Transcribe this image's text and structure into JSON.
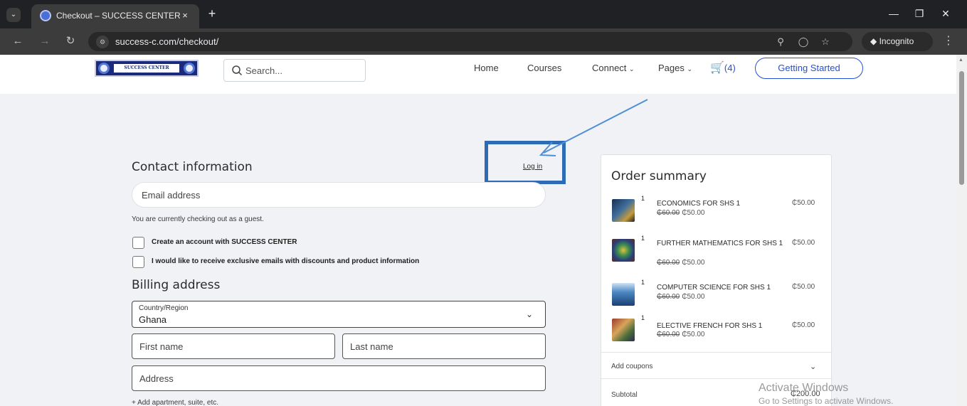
{
  "browser": {
    "tab_title": "Checkout – SUCCESS CENTER",
    "tab_close": "×",
    "new_tab": "+",
    "url": "success-c.com/checkout/",
    "incognito_label": "Incognito"
  },
  "header": {
    "logo_text": "SUCCESS CENTER",
    "search_placeholder": "Search...",
    "nav": [
      "Home",
      "Courses",
      "Connect",
      "Pages"
    ],
    "cart_count": "(4)",
    "cta_label": "Getting Started"
  },
  "checkout": {
    "contact_title": "Contact information",
    "login_link": "Log in",
    "email_placeholder": "Email address",
    "guest_note": "You are currently checking out as a guest.",
    "create_account_label": "Create an account with SUCCESS CENTER",
    "emails_opt_in_label": "I would like to receive exclusive emails with discounts and product information",
    "billing_title": "Billing address",
    "country_label": "Country/Region",
    "country_value": "Ghana",
    "first_name_placeholder": "First name",
    "last_name_placeholder": "Last name",
    "address_placeholder": "Address",
    "add_apartment": "+ Add apartment, suite, etc."
  },
  "summary": {
    "title": "Order summary",
    "items": [
      {
        "qty": "1",
        "name": "ECONOMICS FOR SHS 1",
        "old_price": "₵60.00",
        "new_price": "₵50.00",
        "price": "₵50.00"
      },
      {
        "qty": "1",
        "name": "FURTHER MATHEMATICS FOR SHS 1",
        "old_price": "₵60.00",
        "new_price": "₵50.00",
        "price": "₵50.00"
      },
      {
        "qty": "1",
        "name": "COMPUTER SCIENCE FOR SHS 1",
        "old_price": "₵60.00",
        "new_price": "₵50.00",
        "price": "₵50.00"
      },
      {
        "qty": "1",
        "name": "ELECTIVE FRENCH FOR SHS 1",
        "old_price": "₵60.00",
        "new_price": "₵50.00",
        "price": "₵50.00"
      }
    ],
    "coupons_label": "Add coupons",
    "subtotal_label": "Subtotal",
    "subtotal_value": "₵200.00"
  },
  "watermark": {
    "line1": "Activate Windows",
    "line2": "Go to Settings to activate Windows."
  },
  "colors": {
    "accent": "#2450d6",
    "annotation": "#2e6bb6"
  }
}
